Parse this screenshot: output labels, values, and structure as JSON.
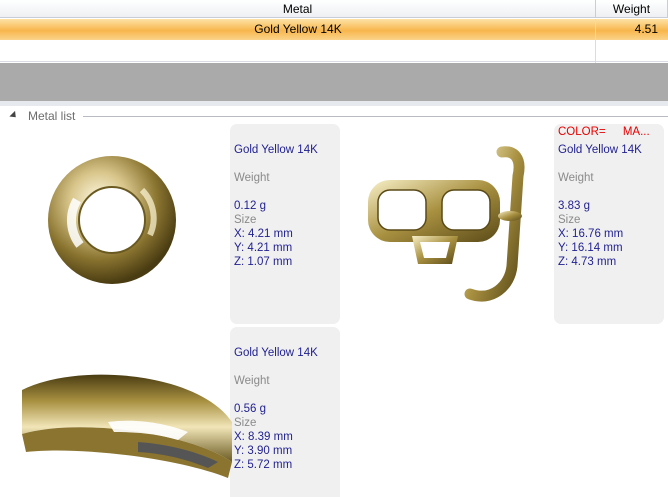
{
  "grid": {
    "columns": [
      "Metal",
      "Weight"
    ],
    "rows": [
      {
        "metal": "Gold Yellow 14K",
        "weight": "4.51"
      }
    ]
  },
  "metal_list": {
    "title": "Metal list",
    "items": [
      {
        "metal": "Gold Yellow 14K",
        "weight_label": "Weight",
        "weight": "0.12 g",
        "size_label": "Size",
        "x": "X: 4.21 mm",
        "y": "Y: 4.21 mm",
        "z": "Z: 1.07 mm"
      },
      {
        "color_label": "COLOR=",
        "color_value": "MA...",
        "metal": "Gold Yellow 14K",
        "weight_label": "Weight",
        "weight": "3.83 g",
        "size_label": "Size",
        "x": "X: 16.76 mm",
        "y": "Y: 16.14 mm",
        "z": "Z: 4.73 mm"
      },
      {
        "metal": "Gold Yellow 14K",
        "weight_label": "Weight",
        "weight": "0.56 g",
        "size_label": "Size",
        "x": "X: 8.39 mm",
        "y": "Y: 3.90 mm",
        "z": "Z: 5.72 mm"
      }
    ]
  }
}
